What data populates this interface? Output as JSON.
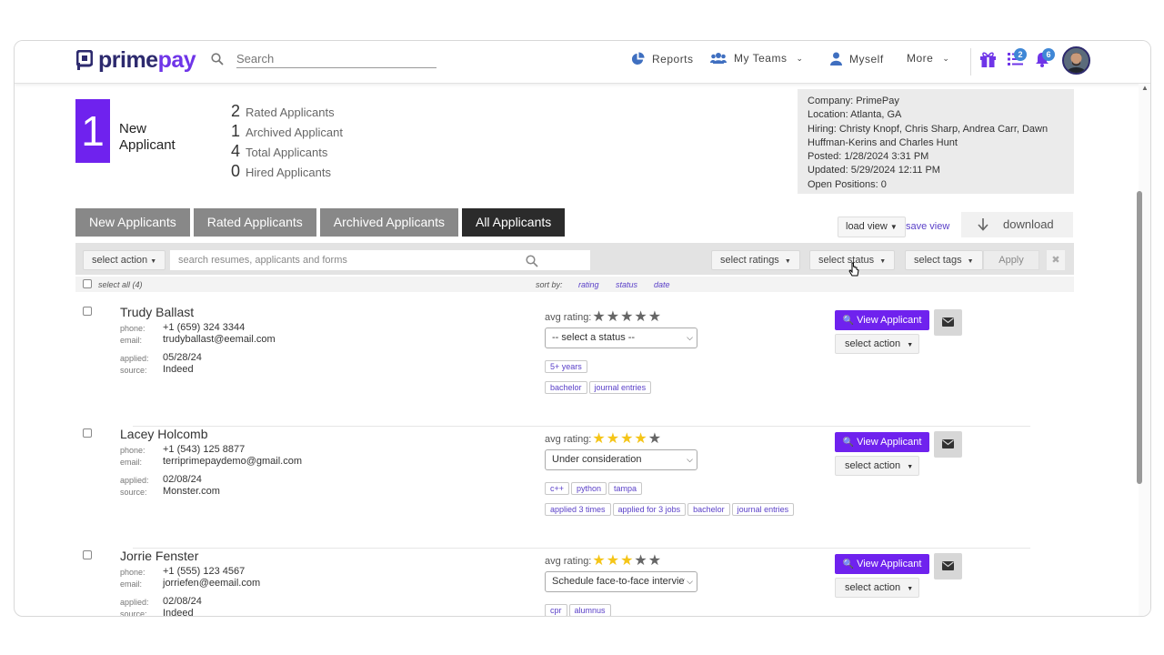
{
  "header": {
    "logo_part1": "prime",
    "logo_part2": "pay",
    "search_placeholder": "Search",
    "nav": {
      "reports": "Reports",
      "my_teams": "My Teams",
      "myself": "Myself",
      "more": "More"
    },
    "tasks_count": "2",
    "notifications_count": "6",
    "colors": {
      "brand_dark": "#2d2a6e",
      "brand_purple": "#6f35e8",
      "badge_blue": "#3f87d6"
    }
  },
  "summary": {
    "new_count": "1",
    "new_label": "New Applicant",
    "stats": [
      {
        "num": "2",
        "label": "Rated Applicants"
      },
      {
        "num": "1",
        "label": "Archived Applicant"
      },
      {
        "num": "4",
        "label": "Total Applicants"
      },
      {
        "num": "0",
        "label": "Hired Applicants"
      }
    ]
  },
  "job_info": {
    "company": "Company: PrimePay",
    "location": "Location: Atlanta, GA",
    "hiring": "Hiring: Christy Knopf, Chris Sharp, Andrea Carr, Dawn Huffman-Kerins and Charles Hunt",
    "posted": "Posted: 1/28/2024 3:31 PM",
    "updated": "Updated: 5/29/2024 12:11 PM",
    "open_positions": "Open Positions: 0"
  },
  "tabs": [
    "New Applicants",
    "Rated Applicants",
    "Archived Applicants",
    "All Applicants"
  ],
  "active_tab": "All Applicants",
  "toolbar": {
    "load_view": "load view",
    "save_view": "save view",
    "download": "download"
  },
  "filters": {
    "select_action": "select action",
    "search_placeholder": "search resumes, applicants and forms",
    "select_ratings": "select ratings",
    "select_status": "select status",
    "select_tags": "select tags",
    "apply": "Apply",
    "clear": "✖"
  },
  "list_header": {
    "select_all": "select all (4)",
    "sort_by": "sort by:",
    "sort_rating": "rating",
    "sort_status": "status",
    "sort_date": "date"
  },
  "field_labels": {
    "phone": "phone:",
    "email": "email:",
    "applied": "applied:",
    "source": "source:",
    "avg_rating": "avg rating:"
  },
  "row_actions": {
    "view": "View Applicant",
    "select_action": "select action"
  },
  "applicants": [
    {
      "name": "Trudy Ballast",
      "phone": "+1 (659) 324 3344",
      "email": "trudyballast@eemail.com",
      "applied": "05/28/24",
      "source": "Indeed",
      "rating": 0,
      "status": "-- select a status --",
      "tags": [
        "5+ years",
        "bachelor",
        "journal entries"
      ]
    },
    {
      "name": "Lacey Holcomb",
      "phone": "+1 (543) 125 8877",
      "email": "terriprimepaydemo@gmail.com",
      "applied": "02/08/24",
      "source": "Monster.com",
      "rating": 4,
      "status": "Under consideration",
      "tags": [
        "c++",
        "python",
        "tampa",
        "applied 3 times",
        "applied for 3 jobs",
        "bachelor",
        "journal entries"
      ]
    },
    {
      "name": "Jorrie Fenster",
      "phone": "+1 (555) 123 4567",
      "email": "jorriefen@eemail.com",
      "applied": "02/08/24",
      "source": "Indeed",
      "rating": 3,
      "status": "Schedule face-to-face interview",
      "tags": [
        "cpr",
        "alumnus"
      ]
    }
  ]
}
